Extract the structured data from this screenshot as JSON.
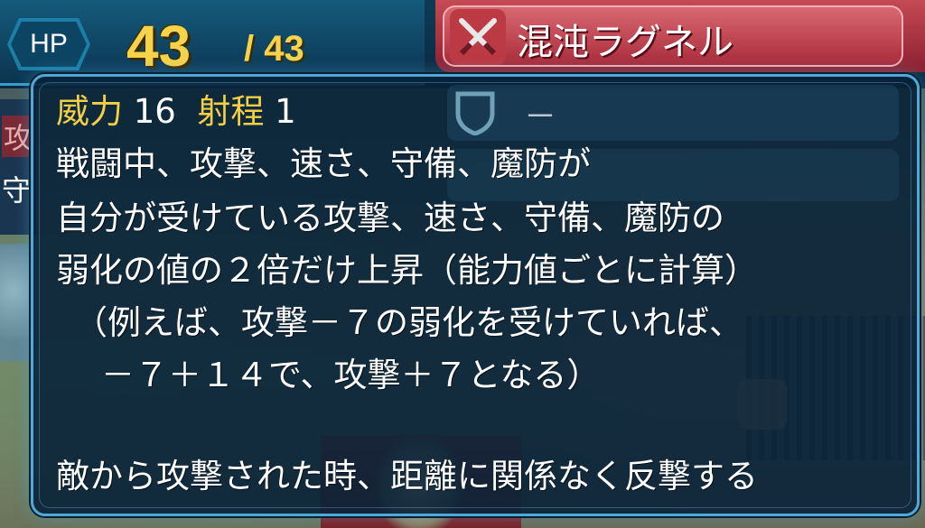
{
  "hud": {
    "hp_label": "HP",
    "hp_current": "43",
    "hp_max": "/ 43",
    "weapon_name": "混沌ラグネル",
    "weapon_icon": "crossed-swords-icon",
    "side_stats": {
      "atk": "攻",
      "def": "守"
    },
    "shield_slot_value": "－"
  },
  "tooltip": {
    "might_label": "威力",
    "might_value": "16",
    "range_label": "射程",
    "range_value": "1",
    "lines": [
      "戦闘中、攻撃、速さ、守備、魔防が",
      "自分が受けている攻撃、速さ、守備、魔防の",
      "弱化の値の２倍だけ上昇（能力値ごとに計算）",
      "（例えば、攻撃－７の弱化を受けていれば、",
      "－７＋１４で、攻撃＋７となる）",
      "敵から攻撃された時、距離に関係なく反撃する"
    ]
  },
  "colors": {
    "accent_gold": "#f2cf45",
    "frame_blue": "#4fa8d8",
    "weapon_red": "#a82a3a"
  }
}
